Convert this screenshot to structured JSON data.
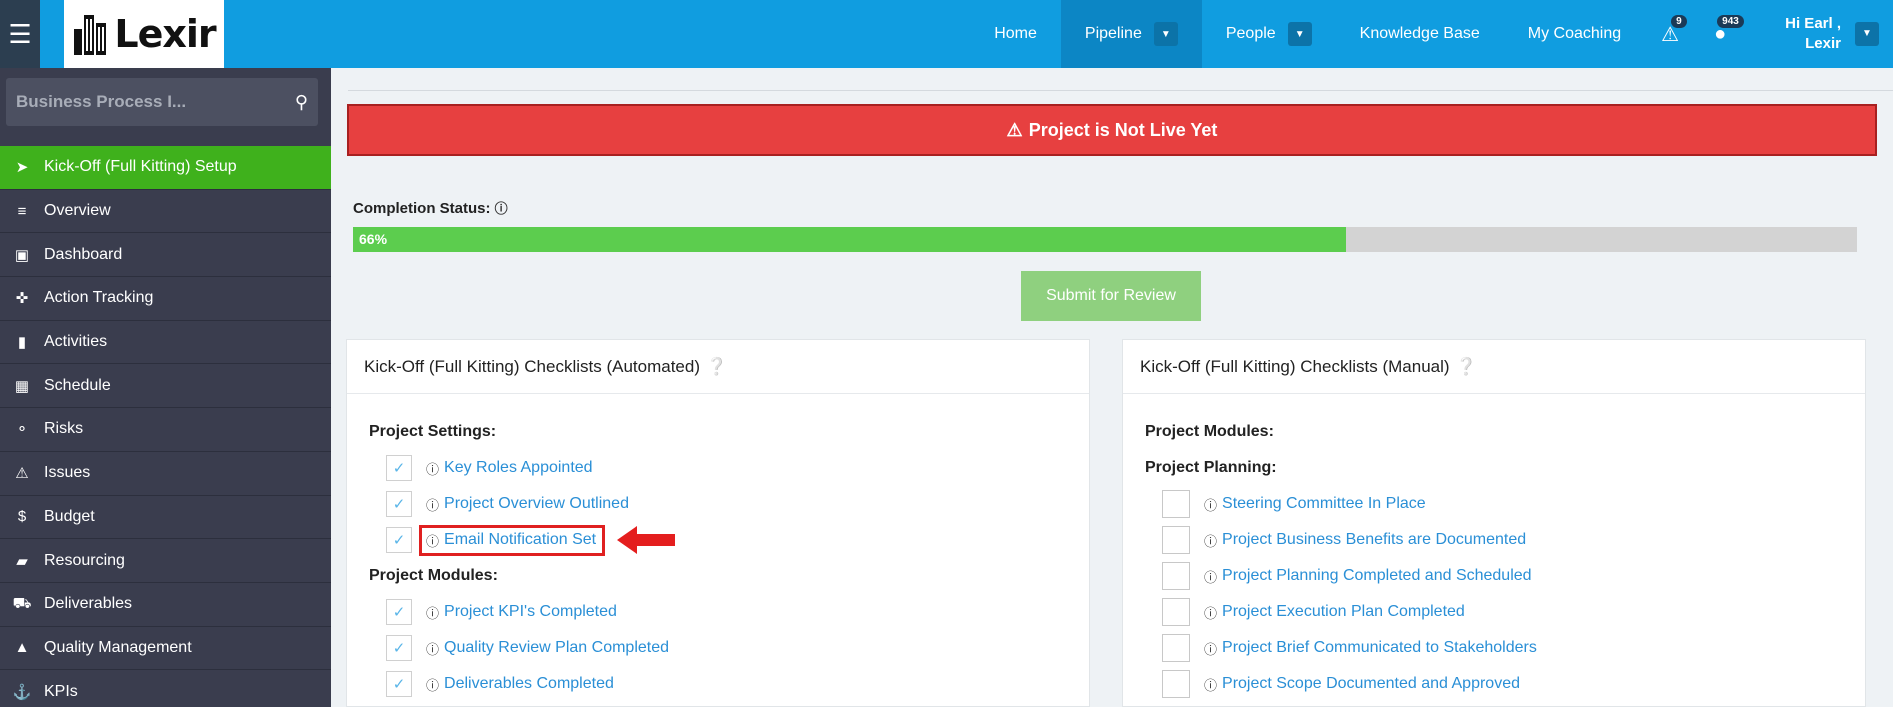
{
  "header": {
    "logo_text": "Lexir",
    "nav": [
      {
        "label": "Home",
        "has_dropdown": false
      },
      {
        "label": "Pipeline",
        "has_dropdown": true,
        "active": true
      },
      {
        "label": "People",
        "has_dropdown": true
      },
      {
        "label": "Knowledge Base",
        "has_dropdown": false
      },
      {
        "label": "My Coaching",
        "has_dropdown": false
      }
    ],
    "alerts_count": "9",
    "notifications_count": "943",
    "user_greeting": "Hi Earl ,",
    "user_org": "Lexir"
  },
  "sidebar": {
    "search_value": "Business Process I...",
    "items": [
      {
        "label": "Kick-Off (Full Kitting) Setup",
        "icon": "rocket-icon",
        "active": true
      },
      {
        "label": "Overview",
        "icon": "list-icon"
      },
      {
        "label": "Dashboard",
        "icon": "dashboard-icon"
      },
      {
        "label": "Action Tracking",
        "icon": "crosshair-icon"
      },
      {
        "label": "Activities",
        "icon": "bookmark-icon"
      },
      {
        "label": "Schedule",
        "icon": "calendar-icon"
      },
      {
        "label": "Risks",
        "icon": "lightbulb-icon"
      },
      {
        "label": "Issues",
        "icon": "warning-icon"
      },
      {
        "label": "Budget",
        "icon": "dollar-icon"
      },
      {
        "label": "Resourcing",
        "icon": "folder-icon"
      },
      {
        "label": "Deliverables",
        "icon": "truck-icon"
      },
      {
        "label": "Quality Management",
        "icon": "thumbs-up-icon"
      },
      {
        "label": "KPIs",
        "icon": "anchor-icon"
      }
    ]
  },
  "main": {
    "alert_text": "Project is Not Live Yet",
    "completion_label": "Completion Status:",
    "completion_percent": 66,
    "completion_text": "66%",
    "submit_label": "Submit for Review",
    "automated_panel": {
      "title": "Kick-Off (Full Kitting) Checklists (Automated)",
      "sections": [
        {
          "label": "Project Settings:",
          "items": [
            {
              "label": "Key Roles Appointed",
              "checked": true
            },
            {
              "label": "Project Overview Outlined",
              "checked": true
            },
            {
              "label": "Email Notification Set",
              "checked": true,
              "highlighted": true
            }
          ]
        },
        {
          "label": "Project Modules:",
          "items": [
            {
              "label": "Project KPI's Completed",
              "checked": true
            },
            {
              "label": "Quality Review Plan Completed",
              "checked": true
            },
            {
              "label": "Deliverables Completed",
              "checked": true
            }
          ]
        }
      ]
    },
    "manual_panel": {
      "title": "Kick-Off (Full Kitting) Checklists (Manual)",
      "modules_label": "Project Modules:",
      "planning_label": "Project Planning:",
      "items": [
        {
          "label": "Steering Committee In Place",
          "checked": false
        },
        {
          "label": "Project Business Benefits are Documented",
          "checked": false
        },
        {
          "label": "Project Planning Completed and Scheduled",
          "checked": false
        },
        {
          "label": "Project Execution Plan Completed",
          "checked": false
        },
        {
          "label": "Project Brief Communicated to Stakeholders",
          "checked": false
        },
        {
          "label": "Project Scope Documented and Approved",
          "checked": false
        }
      ]
    }
  },
  "colors": {
    "header": "#109de0",
    "sidebar": "#3a3d4e",
    "active_green": "#3fb11c",
    "alert_red": "#e74040",
    "progress_green": "#5ccd4e",
    "link_blue": "#2a8fd6"
  }
}
